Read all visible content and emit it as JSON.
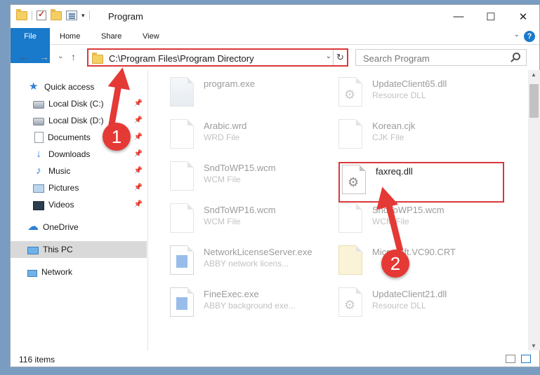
{
  "window": {
    "title": "Program",
    "controls": {
      "minimize": "—",
      "maximize": "☐",
      "close": "✕"
    }
  },
  "ribbon": {
    "tabs": [
      "File",
      "Home",
      "Share",
      "View"
    ],
    "help": "?"
  },
  "address": {
    "path": "C:\\Program Files\\Program Directory",
    "refresh": "↻",
    "dropdown": "⌄"
  },
  "search": {
    "placeholder": "Search Program"
  },
  "nav": {
    "back": "←",
    "forward": "→",
    "recent": "⌄",
    "up": "↑"
  },
  "sidebar": {
    "items": [
      {
        "label": "Quick access",
        "icon": "star-icon",
        "pinned": false
      },
      {
        "label": "Local Disk (C:)",
        "icon": "disk-icon",
        "pinned": true
      },
      {
        "label": "Local Disk (D:)",
        "icon": "disk-icon",
        "pinned": true
      },
      {
        "label": "Documents",
        "icon": "document-icon",
        "pinned": true
      },
      {
        "label": "Downloads",
        "icon": "download-icon",
        "pinned": true
      },
      {
        "label": "Music",
        "icon": "music-icon",
        "pinned": true
      },
      {
        "label": "Pictures",
        "icon": "pictures-icon",
        "pinned": true
      },
      {
        "label": "Videos",
        "icon": "video-icon",
        "pinned": true
      },
      {
        "label": "OneDrive",
        "icon": "cloud-icon",
        "pinned": false
      },
      {
        "label": "This PC",
        "icon": "computer-icon",
        "pinned": false,
        "selected": true
      },
      {
        "label": "Network",
        "icon": "network-icon",
        "pinned": false
      }
    ],
    "pin_glyph": "📌"
  },
  "files": [
    {
      "name": "program.exe",
      "type": "",
      "icon": "exe"
    },
    {
      "name": "UpdateClient65.dll",
      "type": "Resource DLL",
      "icon": "gear"
    },
    {
      "name": "Arabic.wrd",
      "type": "WRD File",
      "icon": "blank"
    },
    {
      "name": "Korean.cjk",
      "type": "CJK File",
      "icon": "blank"
    },
    {
      "name": "SndToWP15.wcm",
      "type": "WCM File",
      "icon": "blank"
    },
    {
      "name": "faxreq.dll",
      "type": "",
      "icon": "gear",
      "highlighted": true
    },
    {
      "name": "SndToWP16.wcm",
      "type": "WCM File",
      "icon": "blank"
    },
    {
      "name": "SndToWP15.wcm",
      "type": "WCM File",
      "icon": "blank"
    },
    {
      "name": "NetworkLicenseServer.exe",
      "type": "ABBY network licens...",
      "icon": "app"
    },
    {
      "name": "Microsoft.VC90.CRT",
      "type": "",
      "icon": "folderish"
    },
    {
      "name": "FineExec.exe",
      "type": "ABBY background exe...",
      "icon": "app"
    },
    {
      "name": "UpdateClient21.dll",
      "type": "Resource DLL",
      "icon": "gear"
    }
  ],
  "status": {
    "count": "116 items"
  },
  "annotations": {
    "step1": "1",
    "step2": "2",
    "color": "#e53935"
  }
}
